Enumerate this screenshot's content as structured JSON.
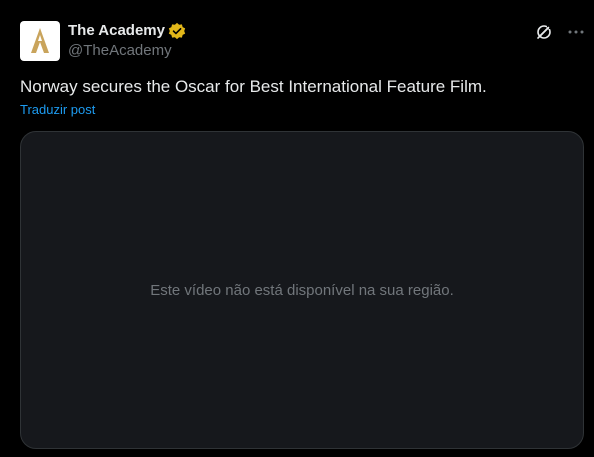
{
  "post": {
    "author": {
      "display_name": "The Academy",
      "handle": "@TheAcademy",
      "verified_color": "#e2b719"
    },
    "text": "Norway secures the Oscar for Best International Feature Film.",
    "translate_label": "Traduzir post",
    "media": {
      "unavailable_message": "Este vídeo não está disponível na sua região."
    },
    "icons": {
      "avatar": "oscar-statue-logo",
      "verified": "verified-badge-icon",
      "grok": "grok-icon",
      "more": "more-icon"
    }
  },
  "colors": {
    "background": "#000000",
    "text_primary": "#e7e9ea",
    "text_secondary": "#71767b",
    "link": "#1d9bf0",
    "media_bg": "#16181c",
    "media_border": "#2f3336",
    "gold": "#c9a45c"
  }
}
